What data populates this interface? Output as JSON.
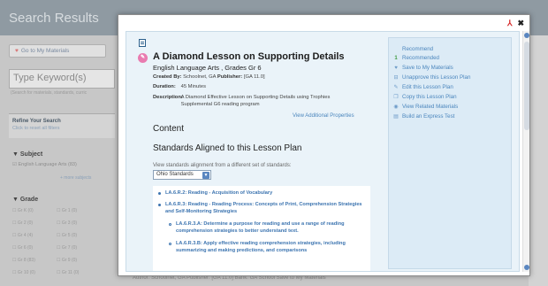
{
  "background": {
    "title": "Search Results",
    "my_materials": "Go to My Materials",
    "search_placeholder": "Type Keyword(s)",
    "search_hint": "(Search for materials, standards, curric",
    "refine_title": "Refine Your Search",
    "refine_sub": "Click to reset all filters",
    "subject_heading": "Subject",
    "subject_item": "English Language Arts (83)",
    "more_subjects": "+ more subjects",
    "grade_heading": "Grade",
    "grades": [
      "Gr K (0)",
      "Gr 1 (0)",
      "Gr 2 (0)",
      "Gr 3 (0)",
      "Gr 4 (4)",
      "Gr 5 (0)",
      "Gr 6 (0)",
      "Gr 7 (0)",
      "Gr 8 (83)",
      "Gr 9 (0)",
      "Gr 10 (0)",
      "Gr 11 (0)"
    ],
    "bottom_line": "Author: Schoolnet, GA  Publisher: [GA 11.0]  Bank: GA School          Save to My Materials"
  },
  "modal": {
    "title": "A Diamond Lesson on Supporting Details",
    "subtitle": "English Language Arts , Grades Gr 6",
    "created_by_label": "Created By:",
    "created_by": "Schoolnet, GA",
    "publisher_label": "Publisher:",
    "publisher": "[GA 11.0]",
    "duration_label": "Duration:",
    "duration": "45 Minutes",
    "description_label": "Description:",
    "description": "A Diamond Effective Lesson on Supporting Details using Trophies Supplemental G6 reading program",
    "view_additional": "View Additional Properties",
    "content_heading": "Content",
    "standards_heading": "Standards Aligned to this Lesson Plan",
    "view_alignment": "View standards alignment from a different set of standards:",
    "standards_select": "Ohio Standards",
    "standards": [
      "LA.6.R.2: Reading - Acquisition of Vocabulary",
      "LA.6.R.3: Reading - Reading Process: Concepts of Print, Comprehension Strategies and Self-Monitoring Strategies",
      "LA.6.R.3.A: Determine a purpose for reading and use a range of reading comprehension strategies to better understand text.",
      "LA.6.R.3.B: Apply effective reading comprehension strategies, including summarizing and making predictions, and comparisons"
    ]
  },
  "actions": [
    {
      "label": "Recommend",
      "icon": "none"
    },
    {
      "label": "Recommended",
      "icon": "count",
      "count": "1"
    },
    {
      "label": "Save to My Materials",
      "icon": "heart-icon"
    },
    {
      "label": "Unapprove this Lesson Plan",
      "icon": "unapprove-icon"
    },
    {
      "label": "Edit this Lesson Plan",
      "icon": "pencil-icon"
    },
    {
      "label": "Copy this Lesson Plan",
      "icon": "copy-icon"
    },
    {
      "label": "View Related Materials",
      "icon": "eye-icon"
    },
    {
      "label": "Build an Express Test",
      "icon": "test-icon"
    }
  ],
  "colors": {
    "link_blue": "#4b86bd",
    "panel_blue": "#dcebf6",
    "inner_bg": "#eaf3f9",
    "pdf_red": "#d62a2a"
  }
}
